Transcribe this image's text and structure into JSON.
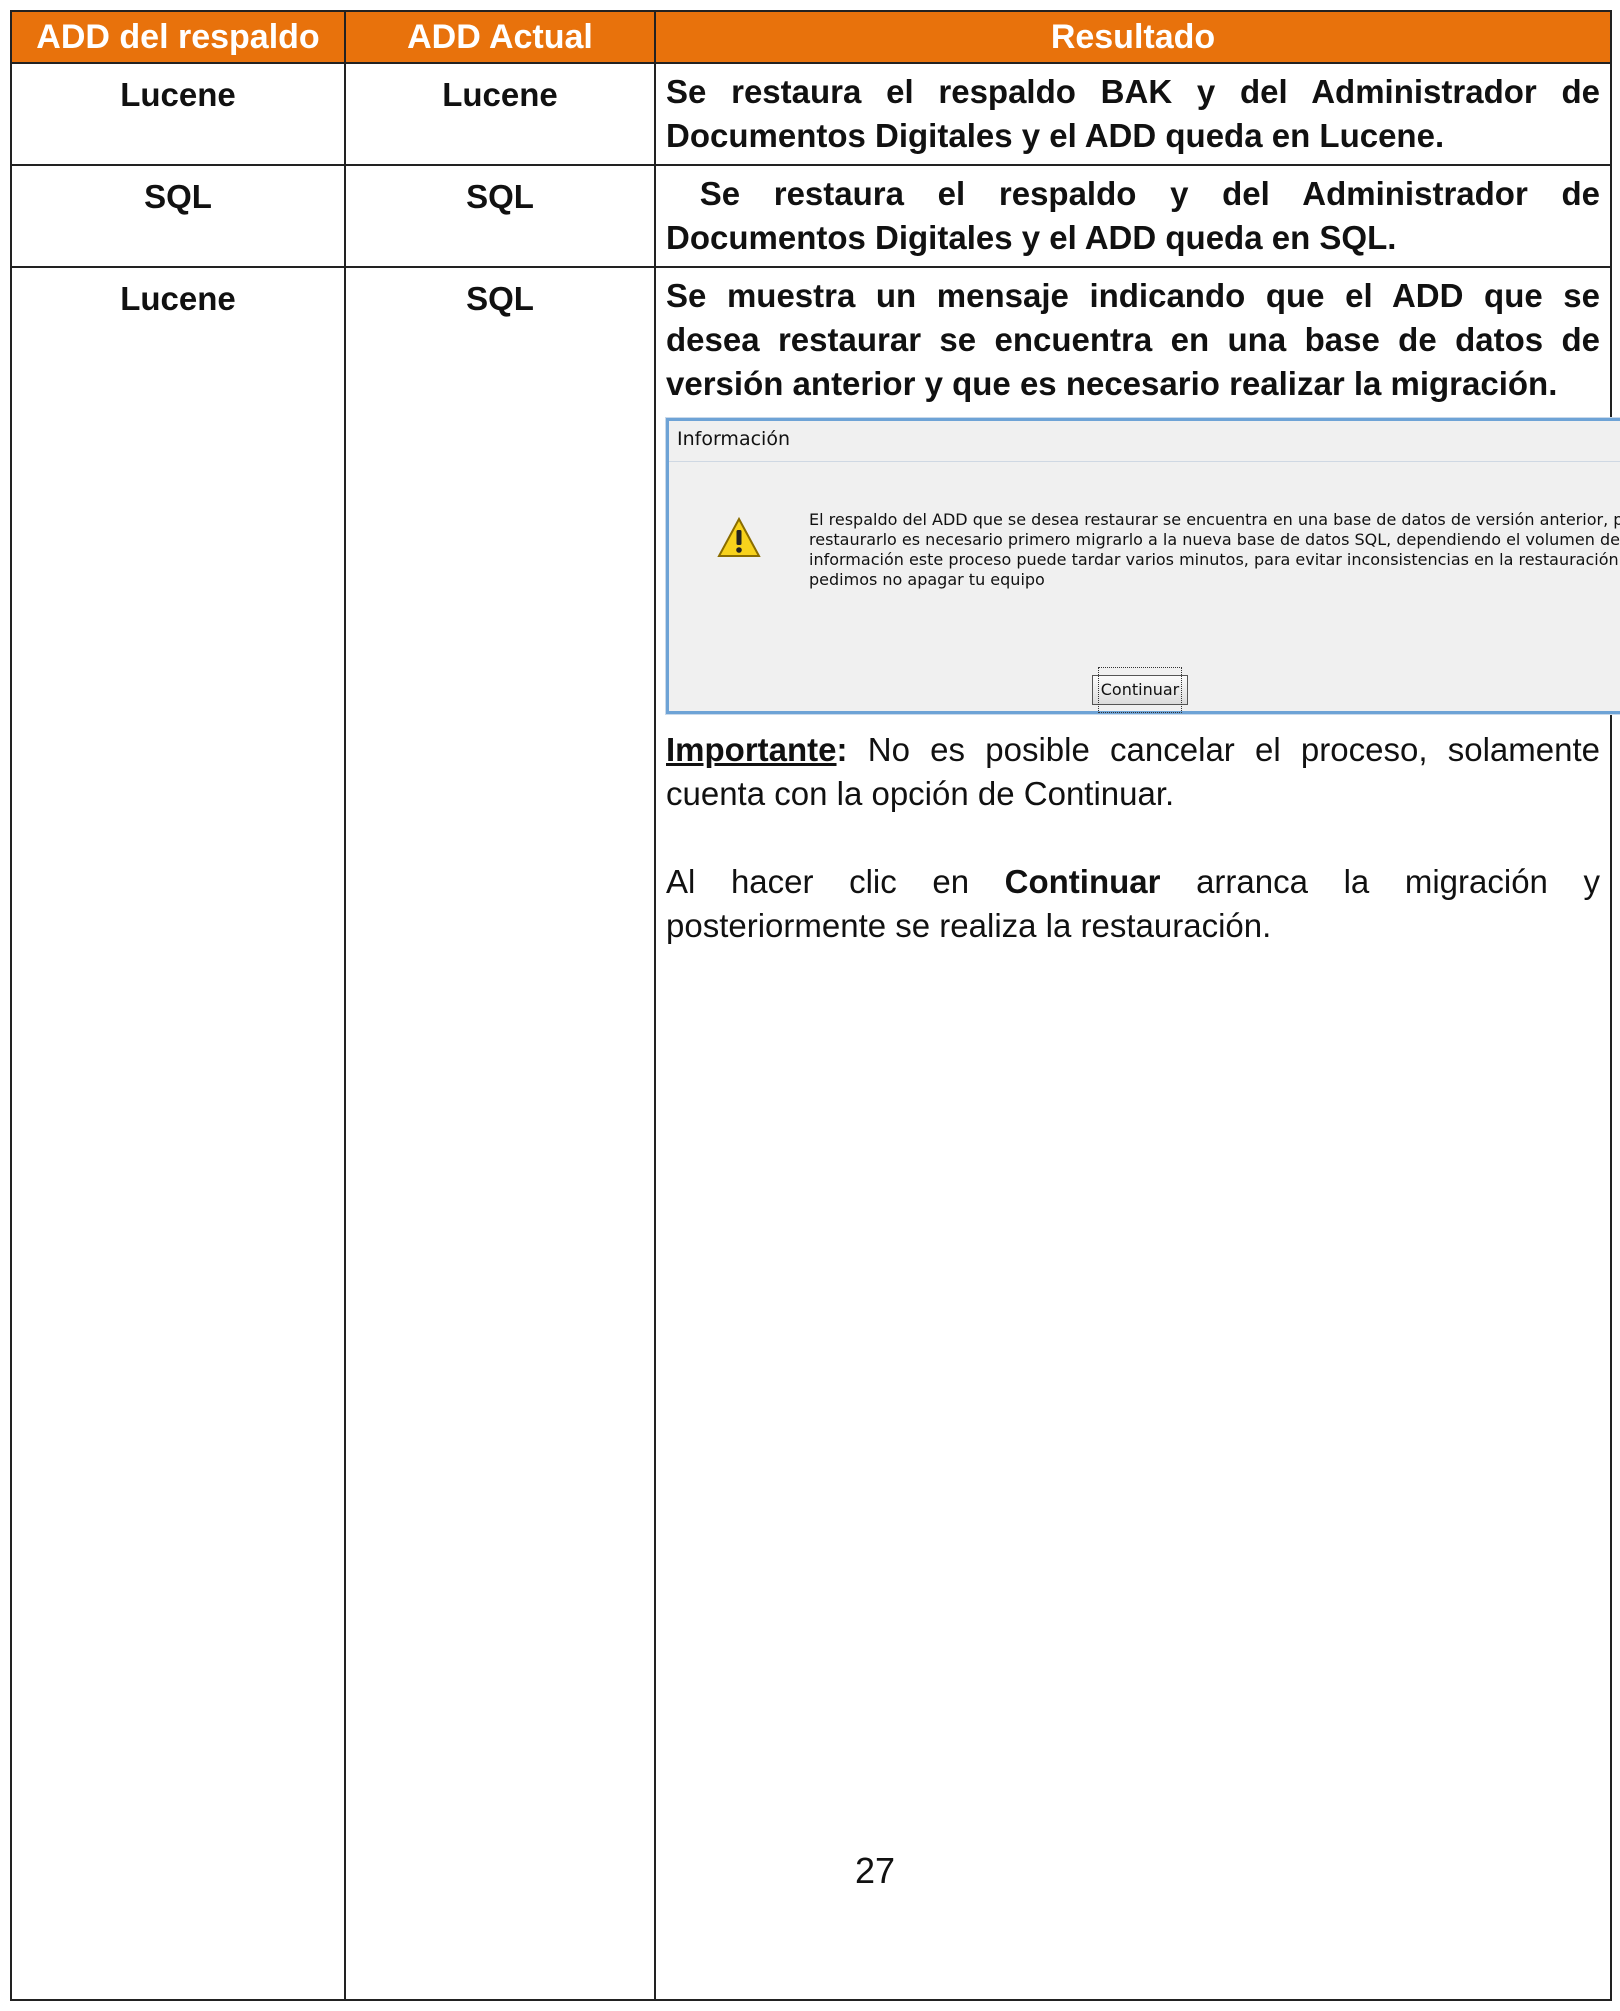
{
  "table": {
    "headers": [
      "ADD del respaldo",
      "ADD Actual",
      "Resultado"
    ],
    "rows": [
      {
        "respaldo": "Lucene",
        "actual": "Lucene",
        "resultado": "Se restaura el respaldo BAK y del Administrador de Documentos Digitales y el ADD queda en Lucene."
      },
      {
        "respaldo": "SQL",
        "actual": "SQL",
        "resultado": " Se restaura el respaldo y del Administrador de Documentos Digitales y el ADD queda en SQL."
      },
      {
        "respaldo": "Lucene",
        "actual": "SQL",
        "resultado": "Se muestra un mensaje indicando que el ADD que se desea restaurar se encuentra en una base de datos de versión anterior y que es necesario realizar la migración."
      }
    ]
  },
  "dialog": {
    "title": "Información",
    "icon": "warning-icon",
    "message": "El respaldo del ADD que se desea restaurar se encuentra en una base de datos de versión anterior, para restaurarlo es necesario primero migrarlo a la nueva base de datos SQL, dependiendo el volumen de información este proceso puede tardar varios minutos, para evitar inconsistencias en la restauración te pedimos no apagar tu equipo",
    "button": "Continuar"
  },
  "note": {
    "label": "Importante",
    "colon": ":",
    "text": " No es posible cancelar el proceso, solamente cuenta con la opción de Continuar."
  },
  "para2": {
    "pre": "Al hacer clic en ",
    "bold": "Continuar",
    "post": " arranca la migración y posteriormente se realiza la restauración."
  },
  "page_number": "27",
  "colors": {
    "header_bg": "#e8720c",
    "header_text": "#ffffff",
    "dialog_border": "#6ea3d6"
  }
}
